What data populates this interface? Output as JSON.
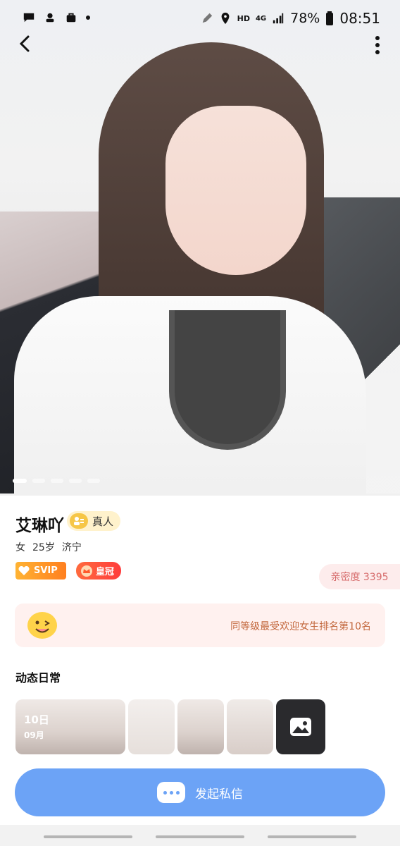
{
  "status": {
    "battery": "78%",
    "time": "08:51",
    "net_hd": "HD",
    "net_4g": "4G"
  },
  "profile": {
    "name": "艾琳吖",
    "real_badge": "真人",
    "gender": "女",
    "age": "25岁",
    "city": "济宁",
    "svip": "SVIP",
    "crown": "皇冠",
    "intimacy": "亲密度 3395",
    "rank_text": "同等级最受欢迎女生排名第10名"
  },
  "gallery": {
    "page_count": 5,
    "current_index": 0
  },
  "moments": {
    "title": "动态日常",
    "date_day": "10日",
    "date_month": "09月"
  },
  "cta": {
    "label": "发起私信"
  },
  "colors": {
    "accent_blue": "#6ca3f6",
    "svip_orange": "#ff8f1f",
    "crown_red": "#ff4d3d",
    "intimacy_pink": "#fdecec"
  },
  "icons": [
    "chat-icon",
    "app-icon",
    "bag-icon",
    "edit-icon",
    "location-icon",
    "signal-icon",
    "battery-icon",
    "back-icon",
    "more-icon",
    "person-badge-icon",
    "heart-icon",
    "crown-icon",
    "emoji-icon",
    "image-icon",
    "message-icon"
  ]
}
